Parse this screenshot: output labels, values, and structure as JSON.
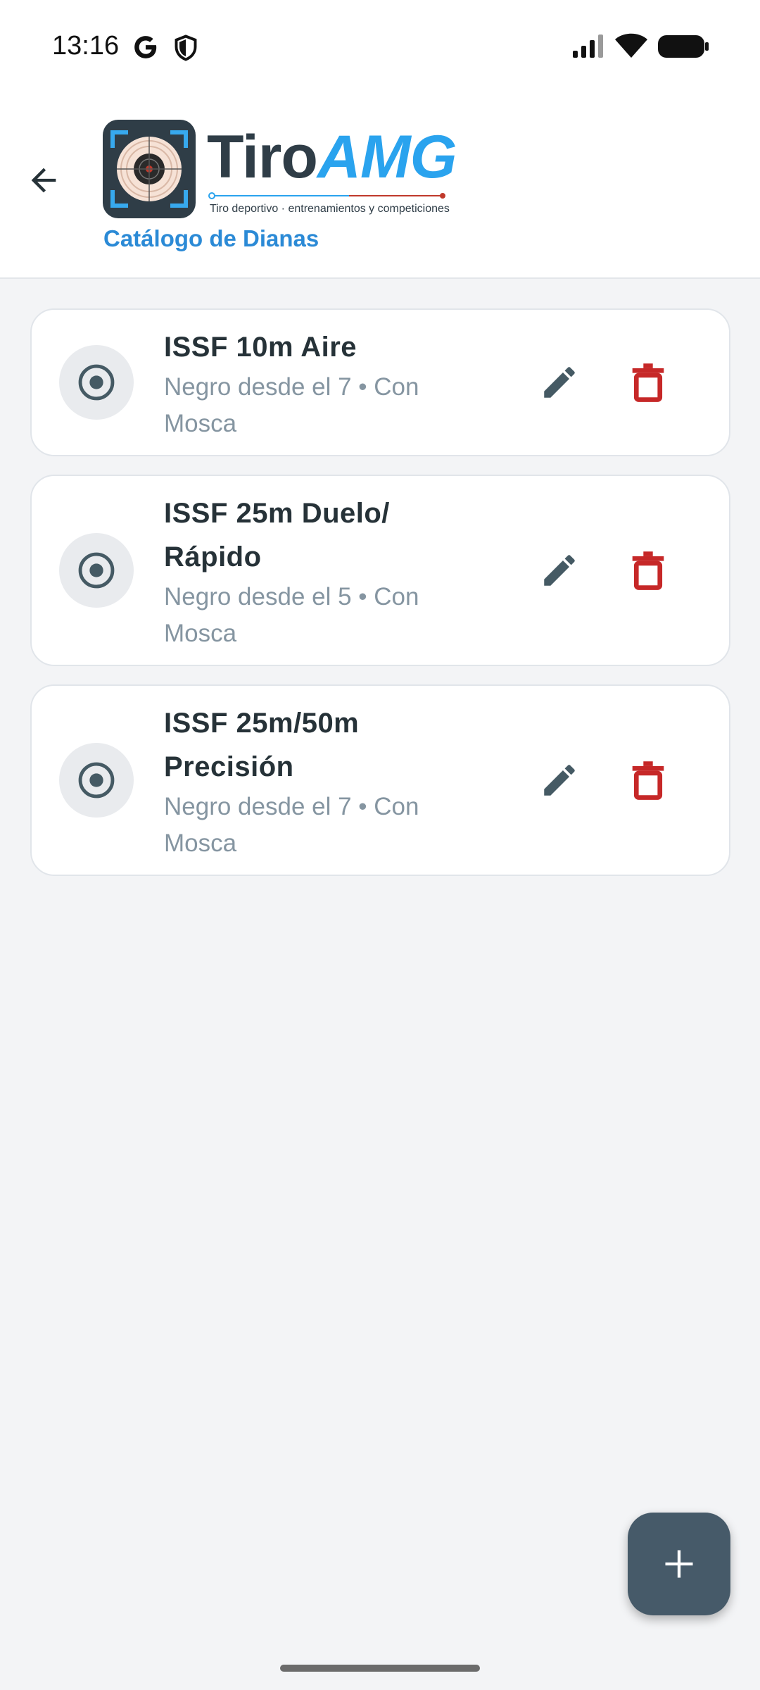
{
  "status_bar": {
    "time": "13:16",
    "icons": [
      "google-g-icon",
      "shield-icon",
      "signal-icon",
      "wifi-icon",
      "battery-icon"
    ]
  },
  "app_bar": {
    "back_icon": "arrow-back-icon",
    "logo": {
      "name_part1": "Tiro",
      "name_part2": "AMG",
      "tagline": "Tiro deportivo · entrenamientos y competiciones"
    },
    "subtitle": "Catálogo de Dianas"
  },
  "targets": [
    {
      "title": "ISSF 10m Aire",
      "subtitle": "Negro desde el 7 • Con Mosca",
      "icon": "target-icon"
    },
    {
      "title": "ISSF 25m Duelo/ Rápido",
      "subtitle": "Negro desde el 5 • Con Mosca",
      "icon": "target-icon"
    },
    {
      "title": "ISSF 25m/50m Precisión",
      "subtitle": "Negro desde el 7 • Con Mosca",
      "icon": "target-icon"
    }
  ],
  "actions": {
    "edit_icon": "pencil-icon",
    "delete_icon": "trash-icon"
  },
  "fab": {
    "icon": "plus-icon"
  },
  "colors": {
    "accent": "#2b8ad6",
    "title_text": "#263238",
    "subtitle_text": "#8595a1",
    "delete": "#c62828",
    "edit": "#455a64",
    "fab": "#465a69",
    "background": "#f3f4f6"
  }
}
